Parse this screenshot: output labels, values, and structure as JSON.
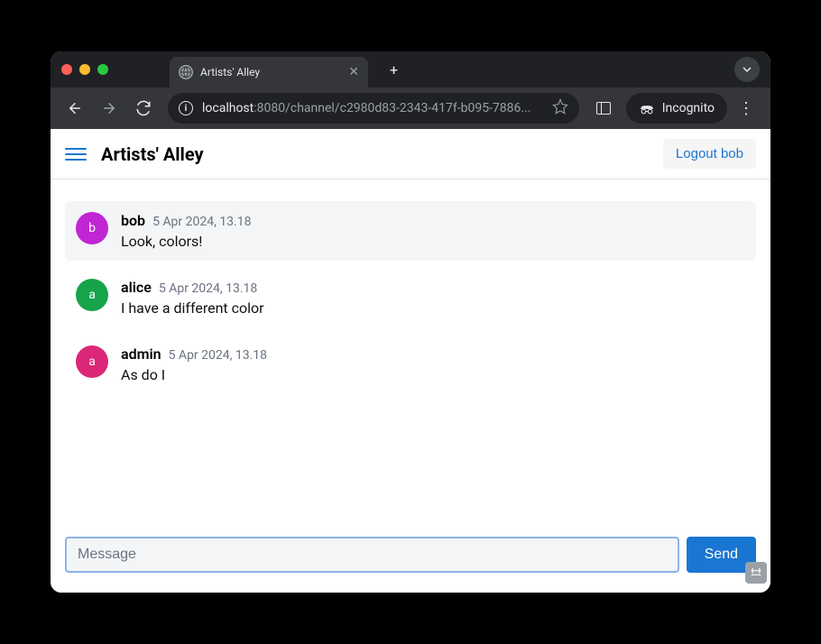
{
  "browser": {
    "tab_title": "Artists' Alley",
    "url_host": "localhost",
    "url_port_path": ":8080/channel/c2980d83-2343-417f-b095-7886...",
    "incognito_label": "Incognito"
  },
  "header": {
    "title": "Artists' Alley",
    "logout_label": "Logout bob"
  },
  "messages": [
    {
      "author": "bob",
      "initial": "b",
      "avatar_color": "#c026d3",
      "timestamp": "5 Apr 2024, 13.18",
      "text": "Look, colors!",
      "highlighted": true
    },
    {
      "author": "alice",
      "initial": "a",
      "avatar_color": "#16a34a",
      "timestamp": "5 Apr 2024, 13.18",
      "text": "I have a different color",
      "highlighted": false
    },
    {
      "author": "admin",
      "initial": "a",
      "avatar_color": "#db2777",
      "timestamp": "5 Apr 2024, 13.18",
      "text": "As do I",
      "highlighted": false
    }
  ],
  "composer": {
    "placeholder": "Message",
    "send_label": "Send"
  }
}
